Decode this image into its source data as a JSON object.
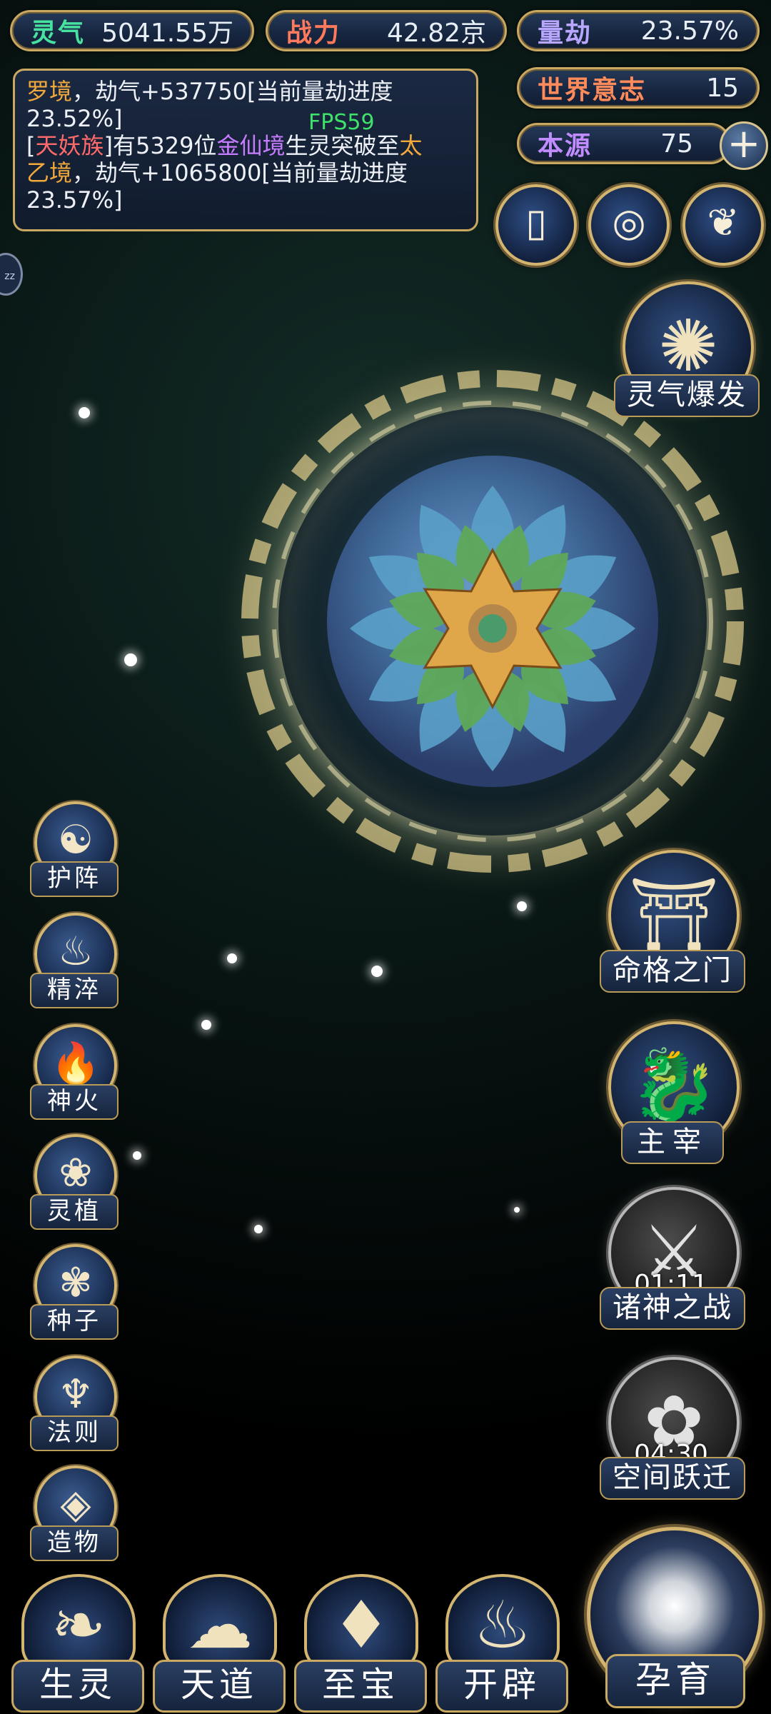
{
  "stats": {
    "lingqi": {
      "label": "灵气",
      "value": "5041.55万",
      "color": "#48e2a0"
    },
    "zhanli": {
      "label": "战力",
      "value": "42.82京",
      "color": "#ff7a5c"
    },
    "liangjie": {
      "label": "量劫",
      "value": "23.57%",
      "color": "#b8a6ff"
    },
    "shijie_yizhi": {
      "label": "世界意志",
      "value": "15",
      "color": "#ff8a5a"
    },
    "benyuan": {
      "label": "本源",
      "value": "75",
      "color": "#c08cff"
    }
  },
  "log": {
    "line1_prefix": "罗境",
    "line1_rest": "，劫气+537750[当前量劫进度",
    "line2": "23.52%]",
    "line3_bracket_open": "[",
    "line3_race": "天妖族",
    "line3_a": "]有5329位",
    "line3_realm": "金仙境",
    "line3_b": "生灵突破至",
    "line3_realm2": "太",
    "line4_realm2": "乙境",
    "line4_rest": "，劫气+1065800[当前量劫进度",
    "line5": "23.57%]"
  },
  "fps": "FPS59",
  "hint_button": "zz",
  "top_icons": [
    {
      "name": "card-icon",
      "glyph": "▯"
    },
    {
      "name": "portal-swirl-icon",
      "glyph": "◎"
    },
    {
      "name": "scroll-icon",
      "glyph": "❦"
    }
  ],
  "right_actions": [
    {
      "label": "灵气爆发",
      "glyph": "✺",
      "timer": ""
    },
    {
      "label": "命格之门",
      "glyph": "⛩",
      "timer": ""
    },
    {
      "label": "主宰",
      "glyph": "🐉",
      "timer": ""
    },
    {
      "label": "诸神之战",
      "glyph": "⚔",
      "timer": "01:11"
    },
    {
      "label": "空间跃迁",
      "glyph": "✿",
      "timer": "04:30"
    }
  ],
  "left_menu": [
    {
      "label": "护阵",
      "glyph": "☯"
    },
    {
      "label": "精淬",
      "glyph": "♨"
    },
    {
      "label": "神火",
      "glyph": "🔥"
    },
    {
      "label": "灵植",
      "glyph": "❀"
    },
    {
      "label": "种子",
      "glyph": "✾"
    },
    {
      "label": "法则",
      "glyph": "♆"
    },
    {
      "label": "造物",
      "glyph": "◈"
    }
  ],
  "bottom_nav": [
    {
      "label": "生灵",
      "glyph": "❧"
    },
    {
      "label": "天道",
      "glyph": "☁"
    },
    {
      "label": "至宝",
      "glyph": "♦"
    },
    {
      "label": "开辟",
      "glyph": "♨"
    }
  ],
  "main_action": {
    "label": "孕育"
  },
  "colors": {
    "gold": "#c9a862",
    "race": "#ff6a6a",
    "realm": "#c77bff",
    "realm2": "#f0a93a",
    "prefix": "#f0a93a",
    "fps": "#3ee26a"
  }
}
